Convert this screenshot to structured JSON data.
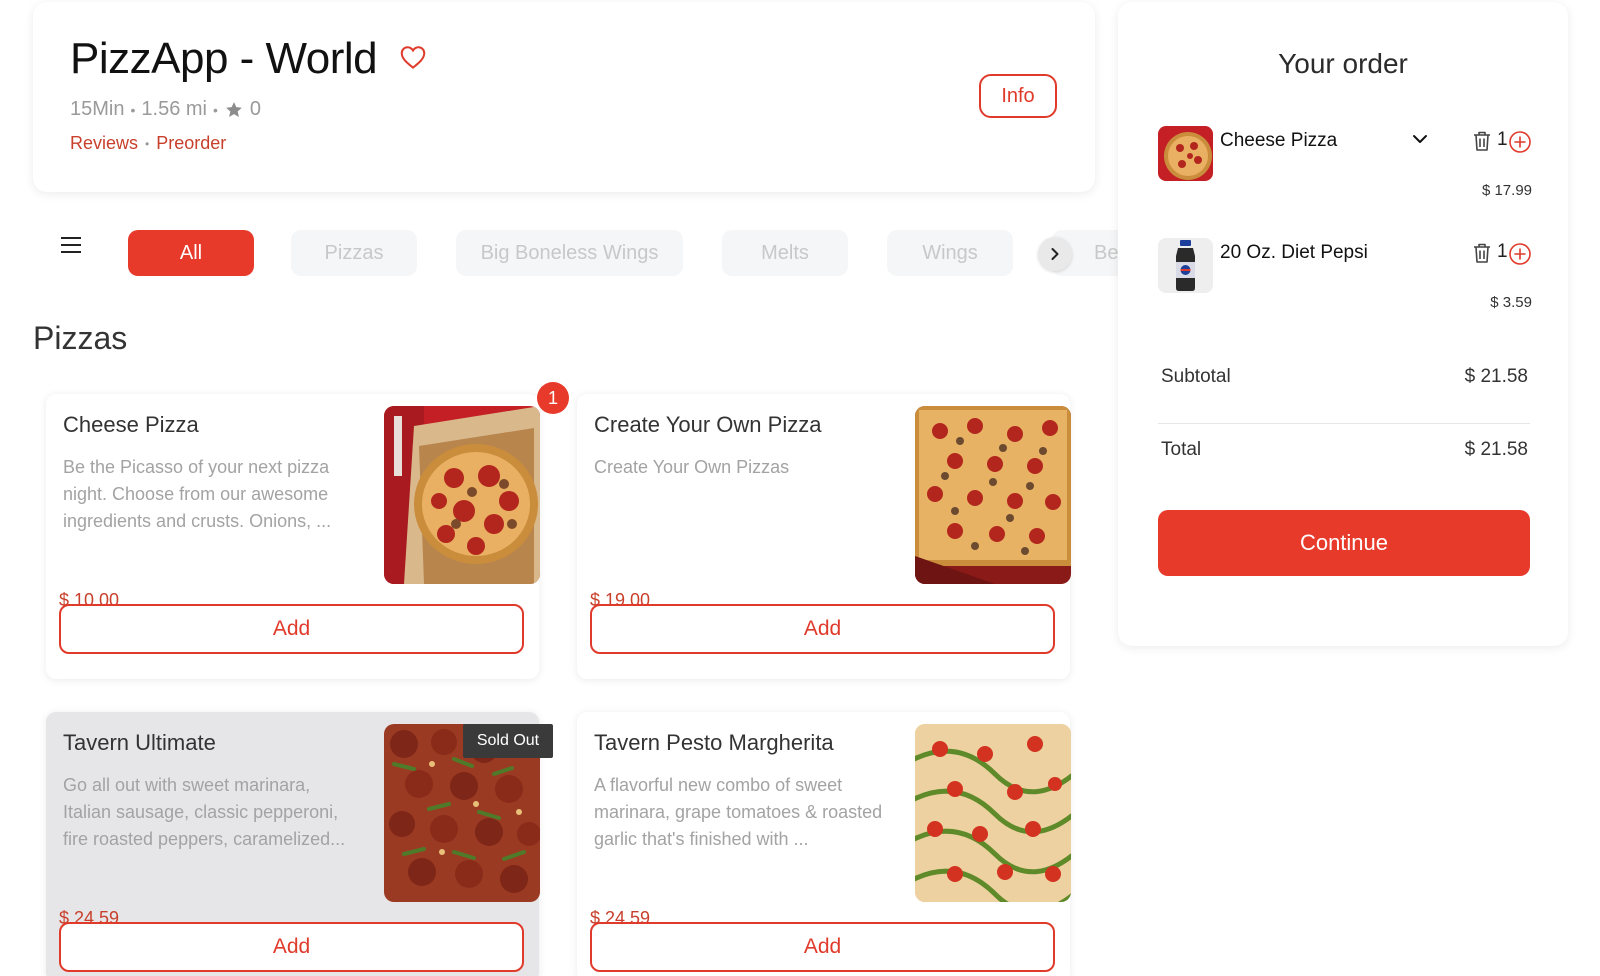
{
  "store": {
    "title": "PizzApp - World",
    "time": "15Min",
    "distance": "1.56 mi",
    "rating": "0",
    "links": {
      "reviews": "Reviews",
      "preorder": "Preorder"
    },
    "info_label": "Info"
  },
  "categories": {
    "items": [
      "All",
      "Pizzas",
      "Big Boneless Wings",
      "Melts",
      "Wings",
      "Bev"
    ],
    "active": "All"
  },
  "section": {
    "title": "Pizzas"
  },
  "products": [
    {
      "name": "Cheese Pizza",
      "description": "Be the Picasso of your next pizza night. Choose from our awesome ingredients and crusts. Onions, ...",
      "price": "$ 10.00",
      "add_label": "Add",
      "badge": "1"
    },
    {
      "name": "Create Your Own Pizza",
      "description": "Create Your Own Pizzas",
      "price": "$ 19.00",
      "add_label": "Add"
    },
    {
      "name": "Tavern Ultimate",
      "description": "Go all out with sweet marinara, Italian sausage, classic pepperoni, fire roasted peppers, caramelized...",
      "price": "$ 24.59",
      "add_label": "Add",
      "tag": "Sold Out"
    },
    {
      "name": "Tavern Pesto Margherita",
      "description": "A flavorful new combo of sweet marinara, grape tomatoes & roasted garlic that's finished with ...",
      "price": "$ 24.59",
      "add_label": "Add"
    }
  ],
  "order": {
    "title": "Your order",
    "items": [
      {
        "name": "Cheese Pizza",
        "qty": "1",
        "price": "$ 17.99"
      },
      {
        "name": "20 Oz. Diet Pepsi",
        "qty": "1",
        "price": "$ 3.59"
      }
    ],
    "subtotal_label": "Subtotal",
    "subtotal_value": "$ 21.58",
    "total_label": "Total",
    "total_value": "$ 21.58",
    "continue_label": "Continue"
  },
  "colors": {
    "accent": "#e83a2a",
    "link": "#c8402c",
    "muted": "#a3a3a3"
  },
  "icons": [
    "heart-icon",
    "star-icon",
    "menu-icon",
    "chevron-right-icon",
    "chevron-down-icon",
    "trash-icon",
    "plus-circle-icon"
  ]
}
